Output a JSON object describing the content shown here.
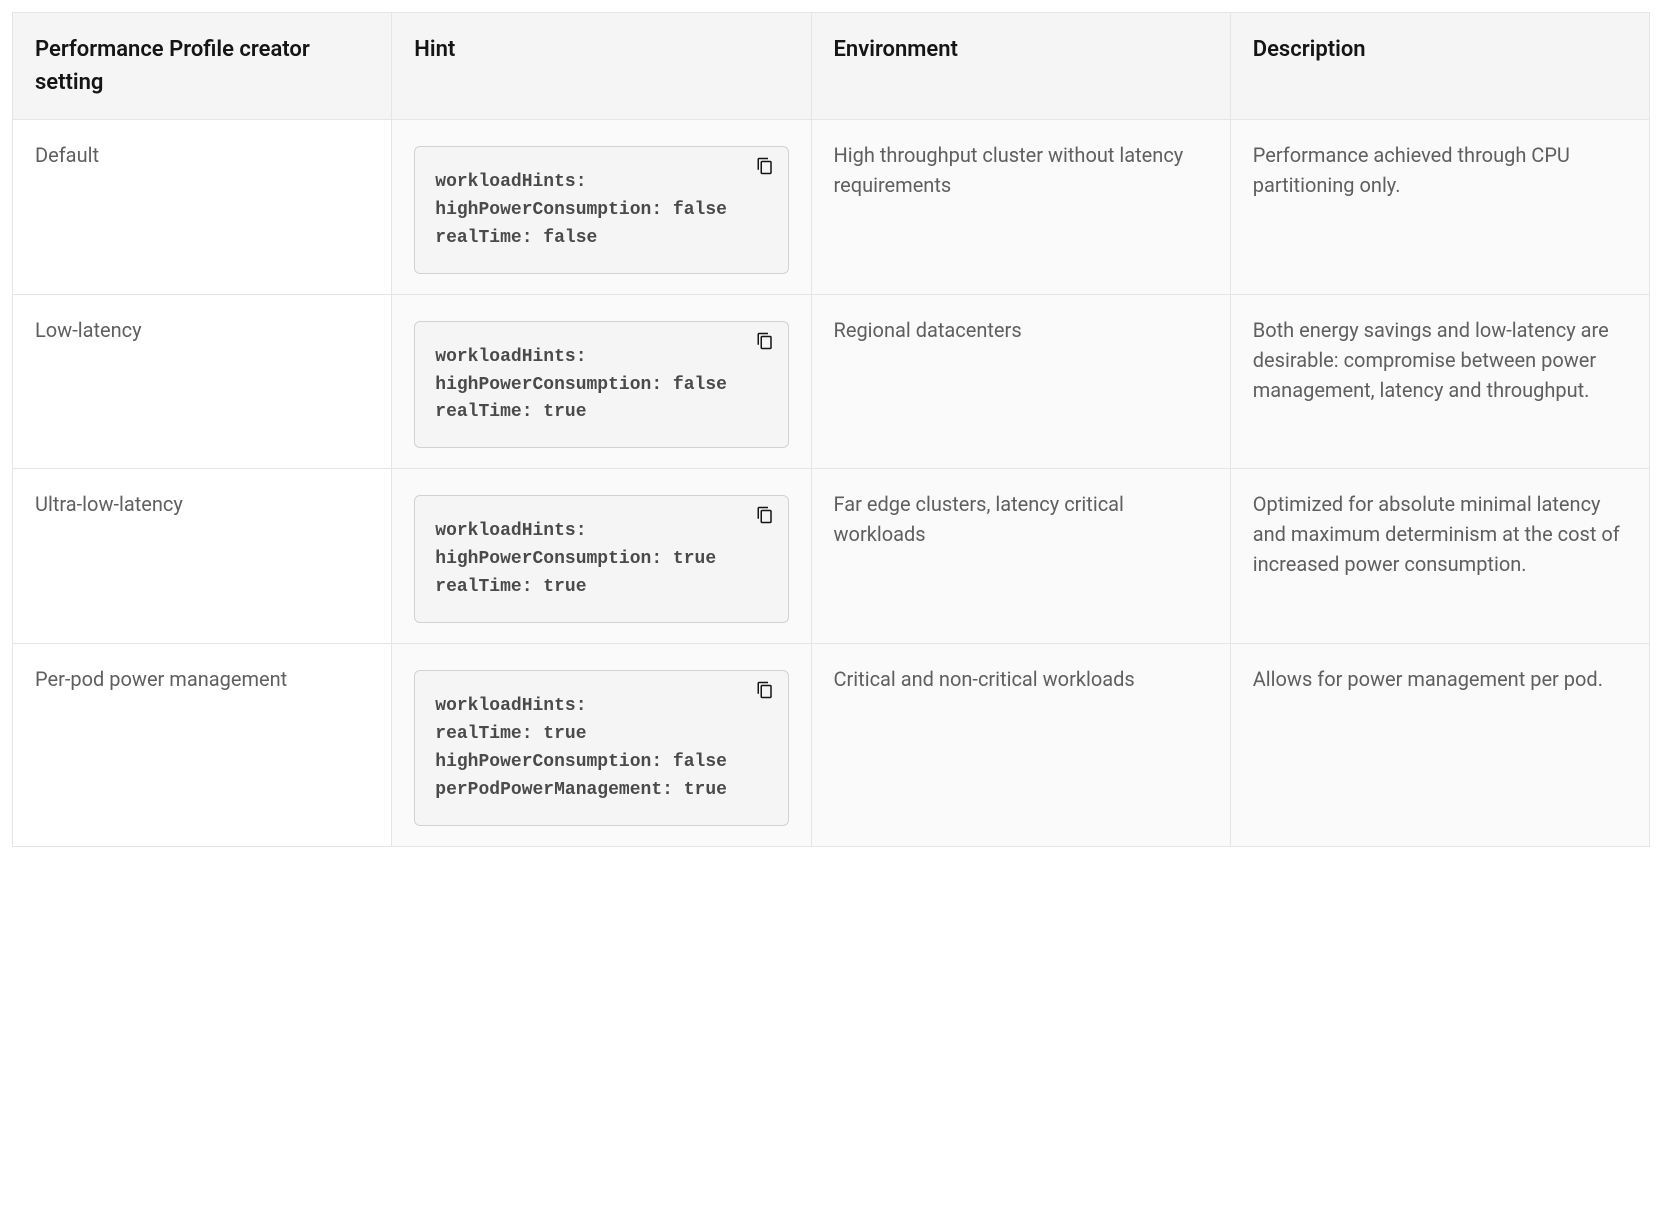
{
  "table": {
    "headers": {
      "setting": "Performance Profile creator setting",
      "hint": "Hint",
      "environment": "Environment",
      "description": "Description"
    },
    "rows": [
      {
        "setting": "Default",
        "hint_code": "workloadHints:\nhighPowerConsumption: false\nrealTime: false",
        "environment": "High throughput cluster without latency requirements",
        "description": "Performance achieved through CPU partitioning only."
      },
      {
        "setting": "Low-latency",
        "hint_code": "workloadHints:\nhighPowerConsumption: false\nrealTime: true",
        "environment": "Regional datacenters",
        "description": "Both energy savings and low-latency are desirable: compromise between power management, latency and throughput."
      },
      {
        "setting": "Ultra-low-latency",
        "hint_code": "workloadHints:\nhighPowerConsumption: true\nrealTime: true",
        "environment": "Far edge clusters, latency critical workloads",
        "description": "Optimized for absolute minimal latency and maximum determinism at the cost of increased power consumption."
      },
      {
        "setting": "Per-pod power management",
        "hint_code": "workloadHints:\nrealTime: true\nhighPowerConsumption: false\nperPodPowerManagement: true",
        "environment": "Critical and non-critical workloads",
        "description": "Allows for power management per pod."
      }
    ]
  }
}
